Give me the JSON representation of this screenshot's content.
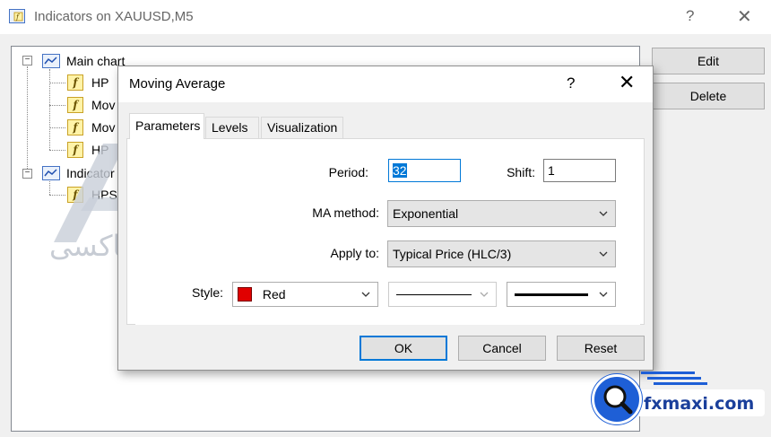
{
  "outer_window": {
    "title": "Indicators on XAUUSD,M5",
    "help_glyph": "?",
    "close_glyph": "✕"
  },
  "tree": {
    "main_chart_label": "Main chart",
    "main_chart_items": [
      "HP",
      "Mov",
      "Mov",
      "HP"
    ],
    "indicator_window_label": "Indicator",
    "indicator_window_items": [
      "HPS"
    ]
  },
  "side_buttons": {
    "edit_label": "Edit",
    "delete_label": "Delete"
  },
  "dialog": {
    "title": "Moving Average",
    "help_glyph": "?",
    "close_glyph": "✕",
    "tabs": [
      "Parameters",
      "Levels",
      "Visualization"
    ],
    "active_tab": "Parameters",
    "period_label": "Period:",
    "period_value": "32",
    "shift_label": "Shift:",
    "shift_value": "1",
    "ma_method_label": "MA method:",
    "ma_method_value": "Exponential",
    "apply_to_label": "Apply to:",
    "apply_to_value": "Typical Price (HLC/3)",
    "style_label": "Style:",
    "style_color_name": "Red",
    "style_color_hex": "#e00000",
    "ok_label": "OK",
    "cancel_label": "Cancel",
    "reset_label": "Reset"
  },
  "watermark": {
    "text": "اف ایکس ماکسی"
  },
  "brand": {
    "name": "fxmaxi.com",
    "accent": "#1e5fd6"
  }
}
